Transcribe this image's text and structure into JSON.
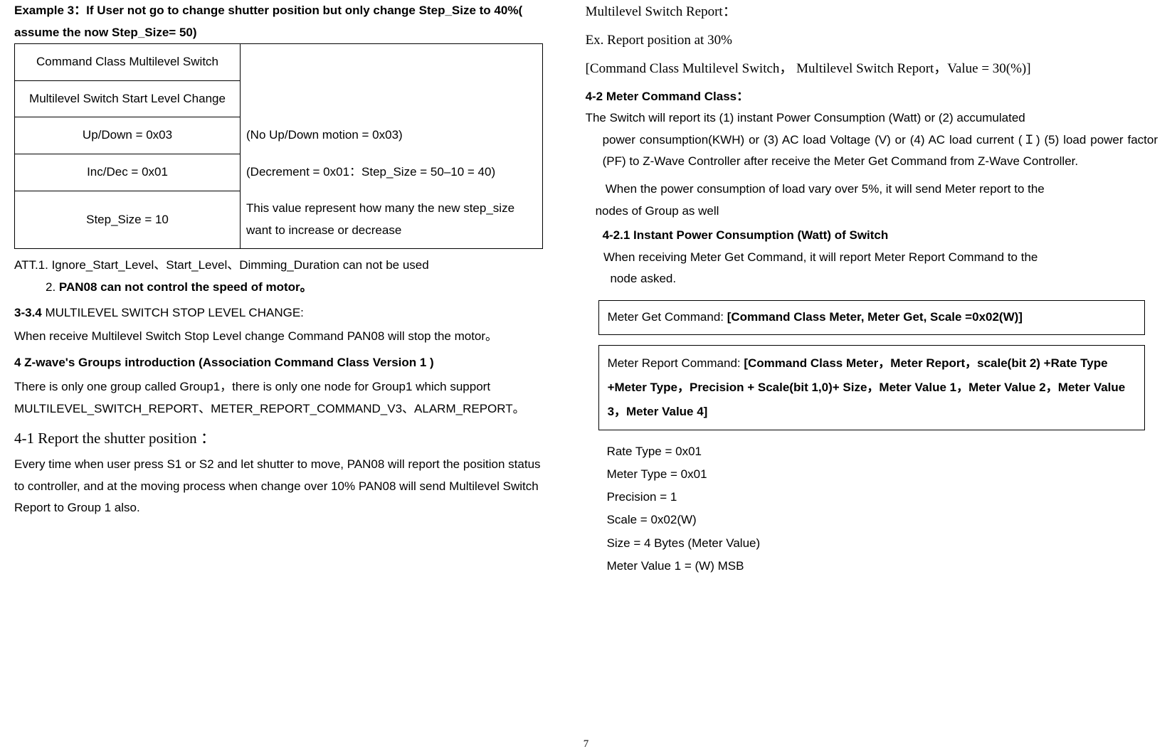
{
  "left": {
    "ex3_title": "Example 3：If User not go to change shutter position but only change Step_Size to 40%( assume the now Step_Size= 50)",
    "table": {
      "r1_l": "Command Class Multilevel Switch",
      "r1_r": "",
      "r2_l": "Multilevel Switch Start Level Change",
      "r2_r": "",
      "r3_l": "Up/Down = 0x03",
      "r3_r": "(No Up/Down motion = 0x03)",
      "r4_l": "Inc/Dec = 0x01",
      "r4_r": "(Decrement = 0x01：Step_Size = 50–10 = 40)",
      "r5_l": "Step_Size = 10",
      "r5_r": "This value represent how many the new step_size want to increase or decrease"
    },
    "att1": "ATT.1. Ignore_Start_Level、Start_Level、Dimming_Duration can not be used",
    "att2_prefix": "2. ",
    "att2_bold": "PAN08 can not control the speed of motor。",
    "h334_prefix": "3-3.4 ",
    "h334_rest": "MULTILEVEL SWITCH STOP LEVEL CHANGE:",
    "p334": "When receive Multilevel Switch Stop Level change Command PAN08 will stop the motor。",
    "h4": "4    Z-wave's Groups introduction (Association Command Class Version 1 )",
    "p4": "There is only one group called Group1，there is only one node for Group1 which support MULTILEVEL_SWITCH_REPORT、METER_REPORT_COMMAND_V3、ALARM_REPORT。",
    "h41": "4-1 Report the shutter position ：",
    "p41": "Every time when user press S1 or S2 and let shutter to move, PAN08 will report the position status to controller, and at the moving process when change over 10% PAN08 will send Multilevel Switch Report to Group 1 also."
  },
  "right": {
    "hmsr": "Multilevel Switch Report：",
    "exline": "Ex. Report position at 30%",
    "cmdline": "[Command Class Multilevel Switch， Multilevel Switch Report，Value = 30(%)]",
    "h42": "4-2 Meter Command Class：",
    "p42a": "The Switch will report its (1) instant Power Consumption (Watt) or (2) accumulated power consumption(KWH) or (3) AC load Voltage (V) or (4) AC load current (Ｉ) (5) load power factor (PF)  to Z-Wave Controller after receive the Meter Get Command from Z-Wave Controller.",
    "p42b": "When the power consumption of load vary over 5%, it will send Meter report to the nodes of Group as well",
    "h421": "4-2.1 Instant Power Consumption (Watt) of Switch",
    "p421": "When receiving Meter Get Command, it will report Meter Report Command to the node asked.",
    "box1_prefix": "Meter Get Command: ",
    "box1_bold": "[Command Class Meter, Meter Get, Scale =0x02(W)]",
    "box2_prefix": "Meter Report Command: ",
    "box2_bold": "[Command Class Meter，Meter Report，scale(bit 2) +Rate Type +Meter Type，Precision + Scale(bit 1,0)+ Size，Meter Value 1，Meter Value 2，Meter Value 3，Meter Value 4]",
    "params": {
      "p1": "Rate Type = 0x01",
      "p2": "Meter Type = 0x01",
      "p3": "Precision = 1",
      "p4": "Scale = 0x02(W)",
      "p5": "Size = 4 Bytes (Meter Value)",
      "p6": "Meter Value 1 = (W) MSB"
    }
  },
  "page_number": "7"
}
